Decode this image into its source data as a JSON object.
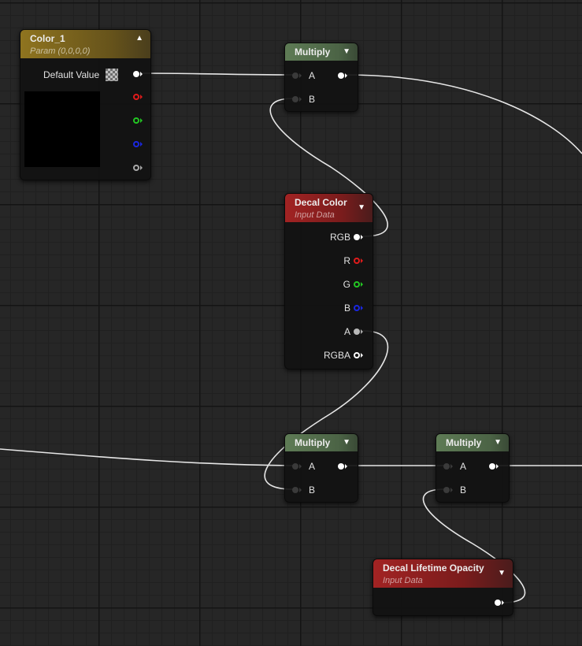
{
  "graph": {
    "color_param": {
      "title": "Color_1",
      "subtitle": "Param (0,0,0,0)",
      "default_value_label": "Default Value",
      "collapse_icon": "chevron-up-icon",
      "preview_color": "#000000"
    },
    "multiply_top": {
      "title": "Multiply",
      "pin_a": "A",
      "pin_b": "B"
    },
    "decal_color": {
      "title": "Decal Color",
      "subtitle": "Input Data",
      "outputs": [
        "RGB",
        "R",
        "G",
        "B",
        "A",
        "RGBA"
      ]
    },
    "multiply_mid": {
      "title": "Multiply",
      "pin_a": "A",
      "pin_b": "B"
    },
    "multiply_right": {
      "title": "Multiply",
      "pin_a": "A",
      "pin_b": "B"
    },
    "decal_lifetime_opacity": {
      "title": "Decal Lifetime Opacity",
      "subtitle": "Input Data"
    }
  },
  "colors": {
    "param_header": "#8f741f",
    "math_header": "#5e7b55",
    "input_data_header": "#a22323",
    "pin_red": "#e01b1b",
    "pin_green": "#23c623",
    "pin_blue": "#1a27e0"
  }
}
